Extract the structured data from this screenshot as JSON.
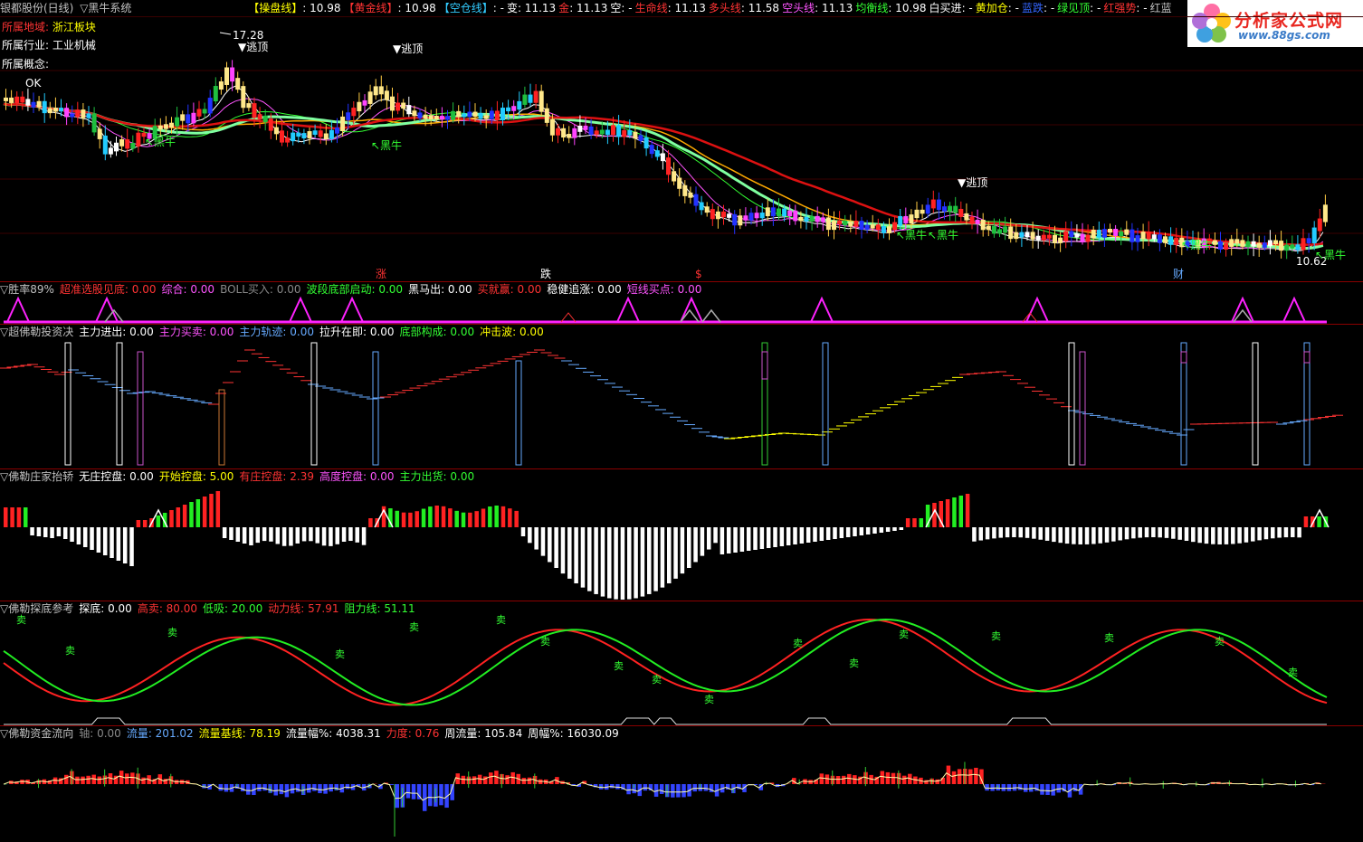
{
  "header": {
    "stock": "银都股份(日线)",
    "system": "▽黑牛系统",
    "items": [
      {
        "label": "【操盘线】",
        "value": ": 10.98",
        "color": "#ffff00"
      },
      {
        "label": "【黄金线】",
        "value": ": 10.98",
        "color": "#ff3333"
      },
      {
        "label": "【空仓线】",
        "value": ": -",
        "color": "#33ccff"
      },
      {
        "label": "变",
        "value": ": 11.13",
        "color": "#ffffff"
      },
      {
        "label": "金",
        "value": ": 11.13",
        "color": "#ff3333"
      },
      {
        "label": "空",
        "value": ": -",
        "color": "#ffffff"
      },
      {
        "label": "生命线",
        "value": ": 11.13",
        "color": "#ff3333"
      },
      {
        "label": "多头线",
        "value": ": 11.58",
        "color": "#ff3333"
      },
      {
        "label": "空头线",
        "value": ": 11.13",
        "color": "#ff55ff"
      },
      {
        "label": "均衡线",
        "value": ": 10.98",
        "color": "#33ff33"
      },
      {
        "label": "白买进",
        "value": ": -",
        "color": "#ffffff"
      },
      {
        "label": "黄加仓",
        "value": ": -",
        "color": "#ffff00"
      },
      {
        "label": "蓝跌",
        "value": ": -",
        "color": "#3366ff"
      },
      {
        "label": "绿见顶",
        "value": ": -",
        "color": "#33ff33"
      },
      {
        "label": "红强势",
        "value": ": -",
        "color": "#ff3333"
      },
      {
        "label": "红蓝",
        "value": "",
        "color": "#c0c0c0"
      }
    ]
  },
  "logo": {
    "title": "分析家公式网",
    "url": "www.88gs.com"
  },
  "info": {
    "region_label": "所属地域:",
    "region": "浙江板块",
    "industry_label": "所属行业:",
    "industry": "工业机械",
    "concept_label": "所属概念:",
    "concept": ""
  },
  "main_annotations": {
    "high": "17.28",
    "low": "10.62",
    "top1": "▼逃顶",
    "top2": "▼逃顶",
    "top3": "▼逃顶",
    "bull": "黑牛",
    "zhang": "涨",
    "die": "跌",
    "s": "$",
    "cai": "财",
    "ok": "OK"
  },
  "panels": [
    {
      "id": "p1",
      "items": [
        {
          "t": "▽胜率89%",
          "c": "#c0c0c0"
        },
        {
          "t": "超准选股见底: 0.00",
          "c": "#ff3333"
        },
        {
          "t": "综合: 0.00",
          "c": "#ff55ff"
        },
        {
          "t": "BOLL买入: 0.00",
          "c": "#888888"
        },
        {
          "t": "波段底部启动: 0.00",
          "c": "#33ff33"
        },
        {
          "t": "黑马出: 0.00",
          "c": "#ffffff"
        },
        {
          "t": "买就赢: 0.00",
          "c": "#ff3333"
        },
        {
          "t": "稳健追涨: 0.00",
          "c": "#ffffff"
        },
        {
          "t": "短线买点: 0.00",
          "c": "#ff55ff"
        }
      ]
    },
    {
      "id": "p2",
      "items": [
        {
          "t": "▽超佛勒投资决",
          "c": "#c0c0c0"
        },
        {
          "t": "主力进出: 0.00",
          "c": "#ffffff"
        },
        {
          "t": "主力买卖: 0.00",
          "c": "#ff55ff"
        },
        {
          "t": "主力轨迹: 0.00",
          "c": "#66aaff"
        },
        {
          "t": "拉升在即: 0.00",
          "c": "#ffffff"
        },
        {
          "t": "底部构成: 0.00",
          "c": "#33ff33"
        },
        {
          "t": "冲击波: 0.00",
          "c": "#ffff00"
        }
      ]
    },
    {
      "id": "p3",
      "items": [
        {
          "t": "▽佛勒庄家抬轿",
          "c": "#c0c0c0"
        },
        {
          "t": "无庄控盘: 0.00",
          "c": "#ffffff"
        },
        {
          "t": "开始控盘: 5.00",
          "c": "#ffff00"
        },
        {
          "t": "有庄控盘: 2.39",
          "c": "#ff3333"
        },
        {
          "t": "高度控盘: 0.00",
          "c": "#ff55ff"
        },
        {
          "t": "主力出货: 0.00",
          "c": "#33ff33"
        }
      ]
    },
    {
      "id": "p4",
      "items": [
        {
          "t": "▽佛勒探底参考",
          "c": "#c0c0c0"
        },
        {
          "t": "探底: 0.00",
          "c": "#ffffff"
        },
        {
          "t": "高卖: 80.00",
          "c": "#ff3333"
        },
        {
          "t": "低吸: 20.00",
          "c": "#33ff33"
        },
        {
          "t": "动力线: 57.91",
          "c": "#ff3333"
        },
        {
          "t": "阻力线: 51.11",
          "c": "#33ff33"
        }
      ]
    },
    {
      "id": "p5",
      "items": [
        {
          "t": "▽佛勒资金流向",
          "c": "#c0c0c0"
        },
        {
          "t": "轴: 0.00",
          "c": "#888888"
        },
        {
          "t": "流量: 201.02",
          "c": "#66aaff"
        },
        {
          "t": "流量基线: 78.19",
          "c": "#ffff00"
        },
        {
          "t": "流量幅%: 4038.31",
          "c": "#ffffff"
        },
        {
          "t": "力度: 0.76",
          "c": "#ff3333"
        },
        {
          "t": "周流量: 105.84",
          "c": "#ffffff"
        },
        {
          "t": "周幅%: 16030.09",
          "c": "#ffffff"
        }
      ]
    }
  ]
}
